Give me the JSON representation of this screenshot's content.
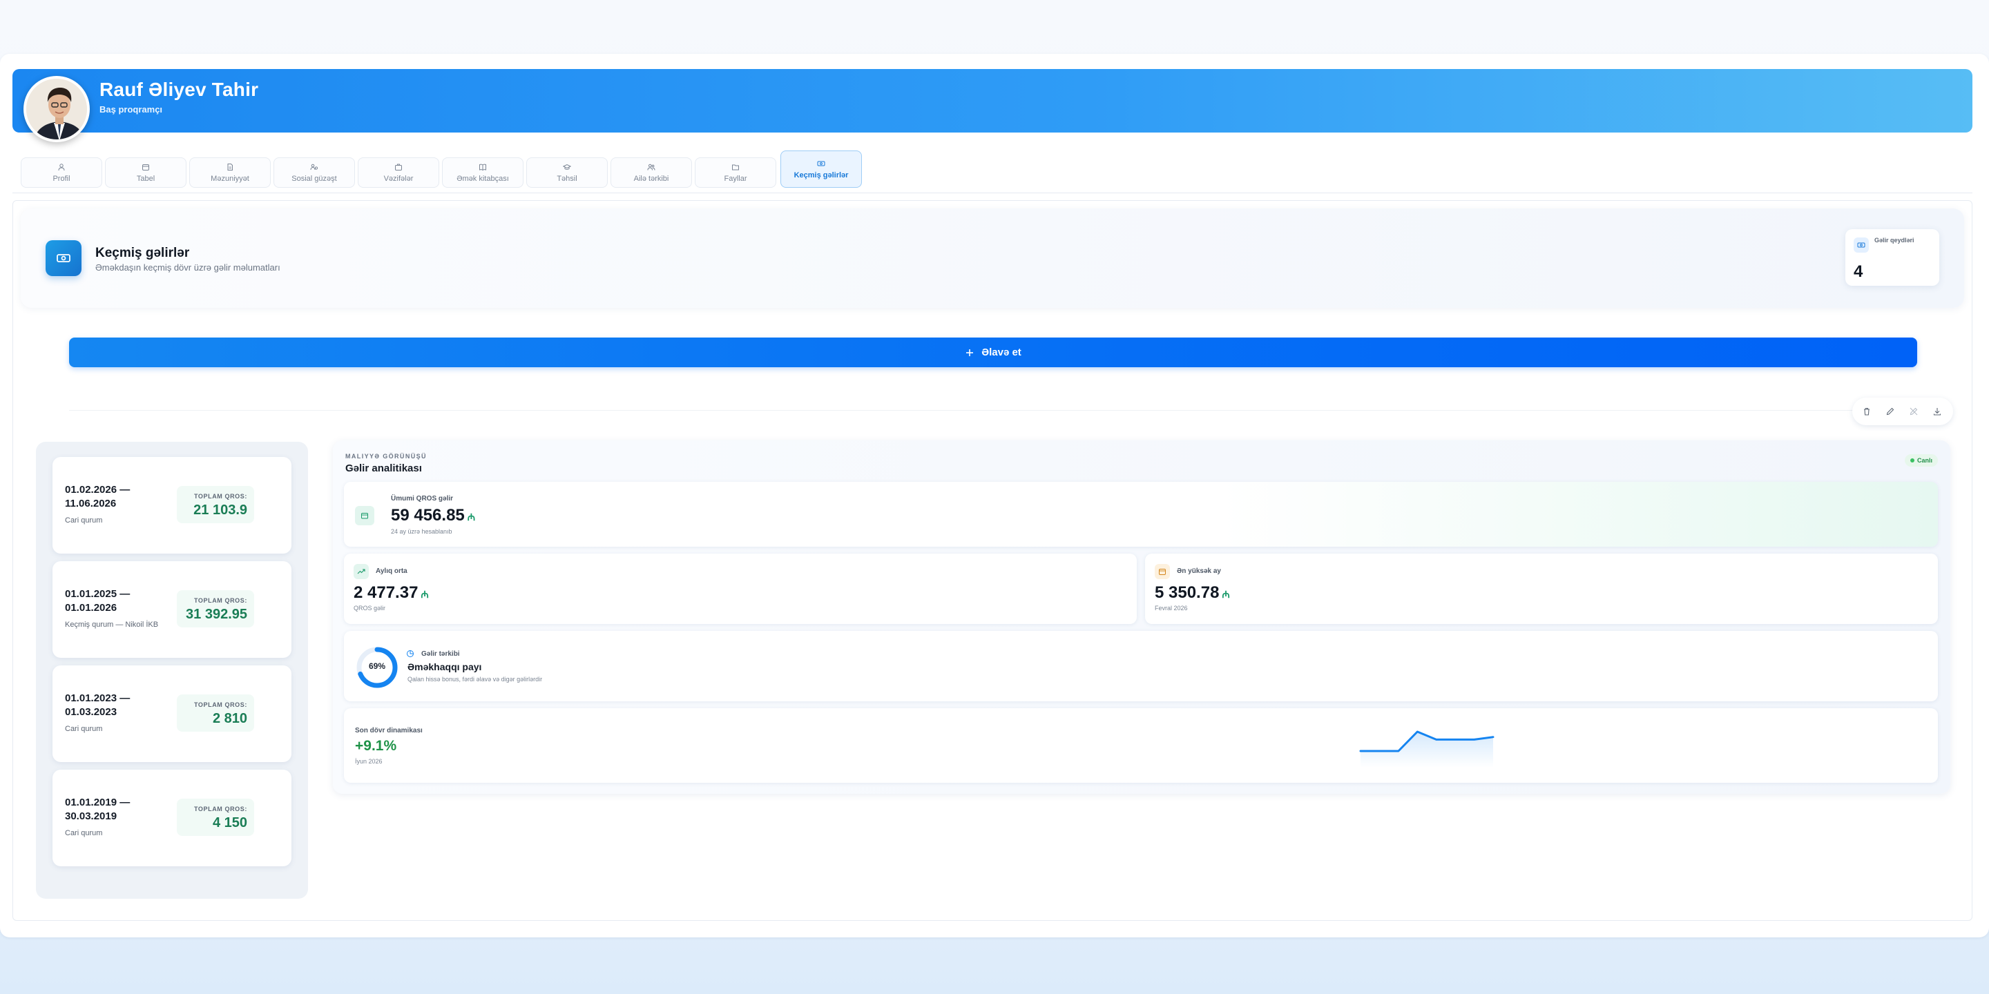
{
  "header": {
    "name": "Rauf Əliyev Tahir",
    "role": "Baş proqramçı"
  },
  "tabs": [
    {
      "label": "Profil",
      "icon": "user-icon"
    },
    {
      "label": "Tabel",
      "icon": "calendar-icon"
    },
    {
      "label": "Məzuniyyət",
      "icon": "document-icon"
    },
    {
      "label": "Sosial güzəşt",
      "icon": "users-gear-icon"
    },
    {
      "label": "Vəzifələr",
      "icon": "briefcase-icon"
    },
    {
      "label": "Əmək kitabçası",
      "icon": "book-icon"
    },
    {
      "label": "Təhsil",
      "icon": "graduation-cap-icon"
    },
    {
      "label": "Ailə tərkibi",
      "icon": "family-icon"
    },
    {
      "label": "Fayllar",
      "icon": "folder-icon"
    },
    {
      "label": "Keçmiş gəlirlər",
      "icon": "money-icon",
      "active": true
    }
  ],
  "section": {
    "title": "Keçmiş gəlirlər",
    "subtitle": "Əməkdaşın keçmiş dövr üzrə gəlir məlumatları",
    "records_label": "Gəlir qeydləri",
    "records_count": "4"
  },
  "add_button": {
    "label": "Əlavə et"
  },
  "periods": [
    {
      "dates": "01.02.2026 — 11.06.2026",
      "org": "Cari qurum",
      "total_label": "TOPLAM QROS:",
      "total": "21 103.9"
    },
    {
      "dates": "01.01.2025 — 01.01.2026",
      "org": "Keçmiş qurum — Nikoil İKB",
      "total_label": "TOPLAM QROS:",
      "total": "31 392.95"
    },
    {
      "dates": "01.01.2023 — 01.03.2023",
      "org": "Cari qurum",
      "total_label": "TOPLAM QROS:",
      "total": "2 810"
    },
    {
      "dates": "01.01.2019 — 30.03.2019",
      "org": "Cari qurum",
      "total_label": "TOPLAM QROS:",
      "total": "4 150"
    }
  ],
  "analytics": {
    "eyebrow": "MALIYYƏ GÖRÜNÜŞÜ",
    "title": "Gəlir analitikası",
    "live": "Canlı",
    "gross": {
      "label": "Ümumi QROS gəlir",
      "value": "59 456.85",
      "currency": "₼",
      "caption": "24 ay üzrə hesablanıb"
    },
    "monthly": {
      "label": "Aylıq orta",
      "value": "2 477.37",
      "currency": "₼",
      "caption": "QROS gəlir"
    },
    "highest": {
      "label": "Ən yüksək ay",
      "value": "5 350.78",
      "currency": "₼",
      "caption": "Fevral 2026"
    },
    "composition": {
      "label": "Gəlir tərkibi",
      "title": "Əməkhaqqı payı",
      "caption": "Qalan hissə bonus, fərdi əlavə və digər gəlirlərdir",
      "percent_text": "69%",
      "percent": 69
    },
    "trend": {
      "label": "Son dövr dinamikası",
      "value": "+9.1%",
      "caption": "İyun 2026",
      "points": [
        2477,
        2477,
        2477,
        5350,
        4180,
        4180,
        4180,
        4560
      ]
    }
  },
  "colors": {
    "accent": "#1b87f1",
    "button": "#066ff5",
    "positive": "#1f9248",
    "money": "#1a7d55"
  }
}
